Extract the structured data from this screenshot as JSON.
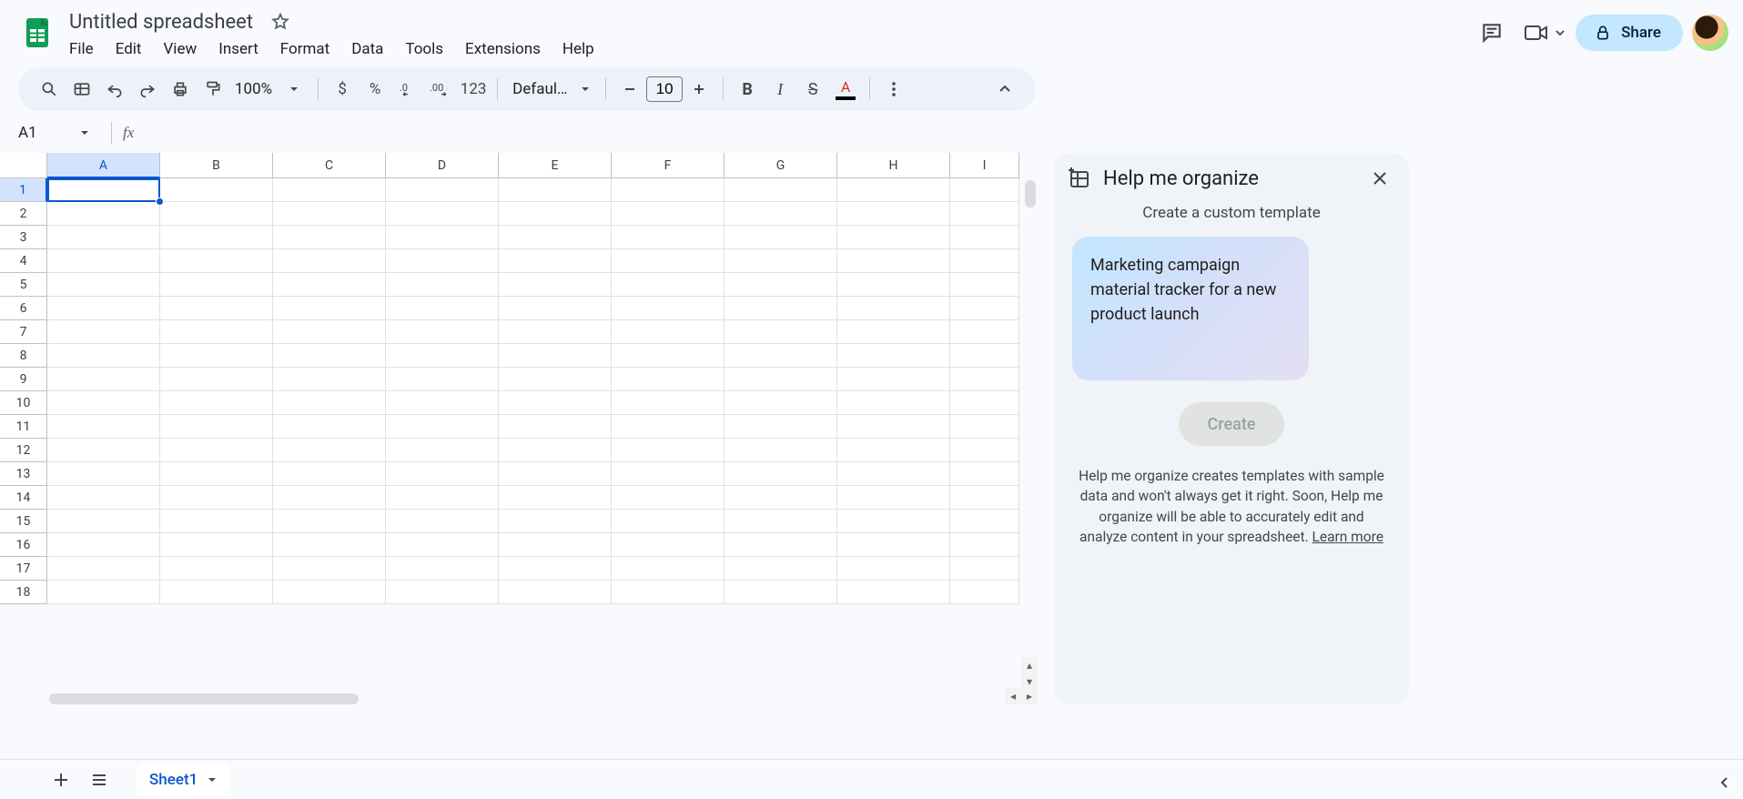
{
  "document": {
    "title": "Untitled spreadsheet",
    "starred": false
  },
  "menus": [
    "File",
    "Edit",
    "View",
    "Insert",
    "Format",
    "Data",
    "Tools",
    "Extensions",
    "Help"
  ],
  "toolbar": {
    "zoom": "100%",
    "currency_label": "$",
    "percent_label": "%",
    "format_123": "123",
    "font_name": "Defaul…",
    "font_size": "10"
  },
  "share_button": "Share",
  "name_box": "A1",
  "formula_bar_value": "",
  "columns": [
    "A",
    "B",
    "C",
    "D",
    "E",
    "F",
    "G",
    "H",
    "I"
  ],
  "rows": [
    "1",
    "2",
    "3",
    "4",
    "5",
    "6",
    "7",
    "8",
    "9",
    "10",
    "11",
    "12",
    "13",
    "14",
    "15",
    "16",
    "17",
    "18"
  ],
  "active_cell": "A1",
  "sheets": {
    "active": "Sheet1"
  },
  "sidepanel": {
    "title": "Help me organize",
    "subtitle": "Create a custom template",
    "prompt": "Marketing campaign material tracker for a new product launch",
    "create_label": "Create",
    "help_text": "Help me organize creates templates with sample data and won't always get it right. Soon, Help me organize will be able to accurately edit and analyze content in your spreadsheet. ",
    "learn_more": "Learn more"
  }
}
